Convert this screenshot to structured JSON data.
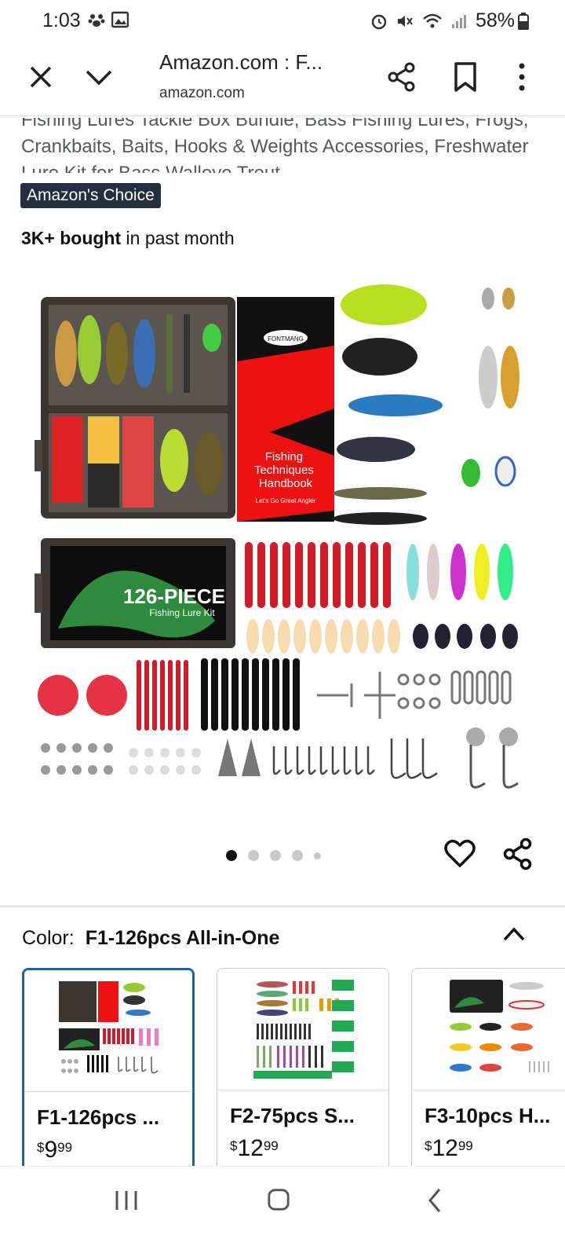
{
  "status_bar": {
    "time": "1:03",
    "battery": "58%"
  },
  "browser": {
    "title": "Amazon.com : F...",
    "url": "amazon.com"
  },
  "product": {
    "title": "Fishing Lures Tackle Box Bundle, Bass Fishing Lures, Frogs, Crankbaits, Baits, Hooks & Weights Accessories, Freshwater Lure Kit for Bass Walleye Trout",
    "badge": "Amazon's Choice",
    "bought_strong": "3K+ bought",
    "bought_rest": " in past month",
    "image_texts": {
      "brand": "FONTMANG",
      "handbook": "Fishing Techniques Handbook",
      "handbook_slogan": "Let's Go Great Angler",
      "kit_title": "126-PIECE",
      "kit_sub": "Fishing Lure Kit"
    }
  },
  "gallery": {
    "total_images": 5,
    "active_index": 0
  },
  "color": {
    "label": "Color:",
    "selected": "F1-126pcs All-in-One",
    "options": [
      {
        "name": "F1-126pcs ...",
        "currency": "$",
        "dollars": "9",
        "cents": "99",
        "selected": true
      },
      {
        "name": "F2-75pcs S...",
        "currency": "$",
        "dollars": "12",
        "cents": "99",
        "selected": false
      },
      {
        "name": "F3-10pcs H...",
        "currency": "$",
        "dollars": "12",
        "cents": "99",
        "selected": false
      }
    ]
  },
  "colors": {
    "badge_bg": "#232f3e",
    "selected_border": "#2162a1"
  },
  "icons": [
    "close-icon",
    "chevron-down-icon",
    "share-icon",
    "bookmark-icon",
    "more-vert-icon",
    "heart-icon",
    "chevron-up-icon",
    "recent-apps-icon",
    "home-icon",
    "back-icon"
  ]
}
